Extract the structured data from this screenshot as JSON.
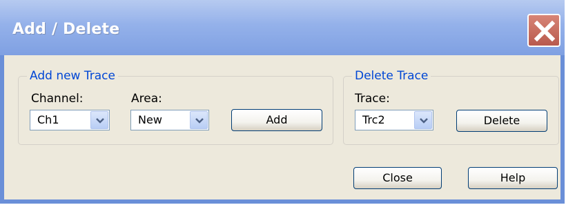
{
  "window": {
    "title": "Add / Delete"
  },
  "add_group": {
    "title": "Add new Trace",
    "channel_label": "Channel:",
    "channel_value": "Ch1",
    "area_label": "Area:",
    "area_value": "New",
    "add_label": "Add"
  },
  "delete_group": {
    "title": "Delete Trace",
    "trace_label": "Trace:",
    "trace_value": "Trc2",
    "delete_label": "Delete"
  },
  "footer": {
    "close_label": "Close",
    "help_label": "Help"
  },
  "icons": {
    "close": "close-x-icon",
    "dropdown": "chevron-down-icon"
  },
  "colors": {
    "titlebar": "#94b1ea",
    "group_title": "#0046d5",
    "close_button": "#c4685b",
    "dialog_bg": "#ede9dc"
  }
}
